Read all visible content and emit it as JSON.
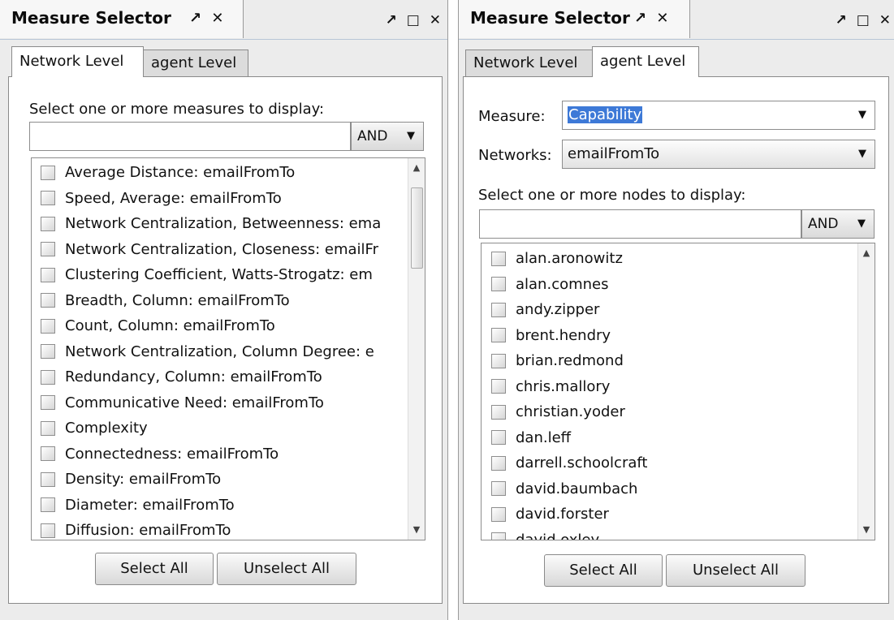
{
  "left_panel": {
    "title": "Measure Selector",
    "tab_pin_icon": "↗",
    "tab_close_icon": "✕",
    "win_pin_icon": "↗",
    "win_maximize_icon": "□",
    "win_close_icon": "✕",
    "tabs": [
      {
        "label": "Network Level",
        "active": true
      },
      {
        "label": "agent Level",
        "active": false
      }
    ],
    "prompt": "Select one or more measures to display:",
    "filter_value": "",
    "and_label": "AND",
    "dropdown_arrow": "▼",
    "scroll_up": "▲",
    "scroll_down": "▼",
    "items": [
      "Average Distance: emailFromTo",
      "Speed, Average: emailFromTo",
      "Network Centralization, Betweenness: ema",
      "Network Centralization, Closeness: emailFr",
      "Clustering Coefficient, Watts-Strogatz: em",
      "Breadth, Column: emailFromTo",
      "Count, Column: emailFromTo",
      "Network Centralization, Column Degree: e",
      "Redundancy, Column: emailFromTo",
      "Communicative Need: emailFromTo",
      "Complexity",
      "Connectedness: emailFromTo",
      "Density: emailFromTo",
      "Diameter: emailFromTo",
      "Diffusion: emailFromTo"
    ],
    "select_all": "Select All",
    "unselect_all": "Unselect All"
  },
  "right_panel": {
    "title": "Measure Selector",
    "tab_pin_icon": "↗",
    "tab_close_icon": "✕",
    "win_pin_icon": "↗",
    "win_maximize_icon": "□",
    "win_close_icon": "✕",
    "tabs": [
      {
        "label": "Network Level",
        "active": false
      },
      {
        "label": "agent Level",
        "active": true
      }
    ],
    "measure_label": "Measure:",
    "measure_value": "Capability",
    "networks_label": "Networks:",
    "networks_value": "emailFromTo",
    "prompt": "Select one or more nodes to display:",
    "filter_value": "",
    "and_label": "AND",
    "dropdown_arrow": "▼",
    "scroll_up": "▲",
    "scroll_down": "▼",
    "items": [
      "alan.aronowitz",
      "alan.comnes",
      "andy.zipper",
      "brent.hendry",
      "brian.redmond",
      "chris.mallory",
      "christian.yoder",
      "dan.leff",
      "darrell.schoolcraft",
      "david.baumbach",
      "david.forster",
      "david.oxley"
    ],
    "select_all": "Select All",
    "unselect_all": "Unselect All"
  }
}
